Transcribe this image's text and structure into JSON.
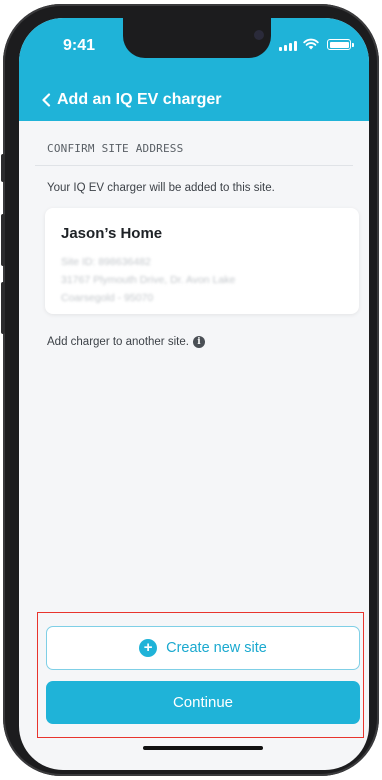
{
  "status_bar": {
    "time": "9:41",
    "icons": [
      "signal-icon",
      "wifi-icon",
      "battery-icon"
    ]
  },
  "header": {
    "back_icon": "chevron-left-icon",
    "title": "Add an IQ EV charger",
    "color": "#1fb3d8"
  },
  "section": {
    "label": "CONFIRM SITE ADDRESS"
  },
  "intro_text": "Your IQ EV charger will be added to this site.",
  "site_card": {
    "name": "Jason’s Home",
    "site_id": "Site ID: 898636482",
    "address_line1": "31767 Plymouth Drive, Dr. Avon Lake",
    "address_line2": "Coarsegold - 95070"
  },
  "another_site": {
    "text": "Add charger to another site.",
    "icon": "info-icon",
    "icon_glyph": "i"
  },
  "actions": {
    "create_label": "Create new site",
    "create_icon": "plus-circle-icon",
    "create_glyph": "+",
    "continue_label": "Continue"
  },
  "colors": {
    "accent": "#1fb3d8",
    "highlight_border": "#e8342d",
    "background": "#f5f6f8"
  }
}
